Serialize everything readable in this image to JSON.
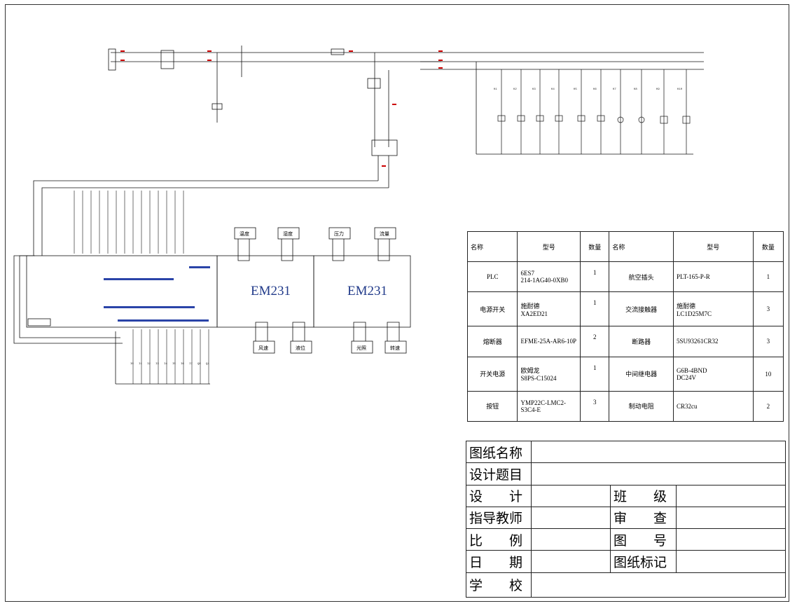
{
  "diagram": {
    "modules": [
      "EM231",
      "EM231"
    ],
    "relay_labels": [
      "K1",
      "K2",
      "K3",
      "K4",
      "K5",
      "K6",
      "K7",
      "K8",
      "K9",
      "K10"
    ],
    "module_boxes_top": [
      "温度",
      "湿度",
      "压力",
      "流量"
    ],
    "module_boxes_bottom": [
      "风速",
      "液位",
      "光照",
      "转速"
    ],
    "io_labels": [
      "I0",
      "I1",
      "I2",
      "I3",
      "I4",
      "I5",
      "I6",
      "I7",
      "Q0",
      "Q1"
    ]
  },
  "parts_table": {
    "headers": [
      "名称",
      "型号",
      "数量",
      "名称",
      "型号",
      "数量"
    ],
    "rows": [
      [
        "PLC",
        "6ES7\n214-1AG40-0XB0",
        "1",
        "航空插头",
        "PLT-165-P-R",
        "1"
      ],
      [
        "电源开关",
        "施耐德\nXA2ED21",
        "1",
        "交流接触器",
        "施耐德\nLC1D25M7C",
        "3"
      ],
      [
        "熔断器",
        "EFME-25A-AR6-10P",
        "2",
        "断路器",
        "5SU93261CR32",
        "3"
      ],
      [
        "开关电源",
        "欧姆龙\nS8PS-C15024",
        "1",
        "中间继电器",
        "G6B-4BND\nDC24V",
        "10"
      ],
      [
        "按钮",
        "YMP22C-LMC2-\nS3C4-E",
        "3",
        "制动电阻",
        "CR32cu",
        "2"
      ]
    ]
  },
  "title_block": {
    "drawing_name": "图纸名称",
    "design_topic": "设计题目",
    "design": "设　　计",
    "class": "班　　级",
    "advisor": "指导教师",
    "review": "审　　查",
    "scale": "比　　例",
    "drawing_no": "图　　号",
    "date": "日　　期",
    "drawing_mark": "图纸标记",
    "school": "学　　校"
  }
}
